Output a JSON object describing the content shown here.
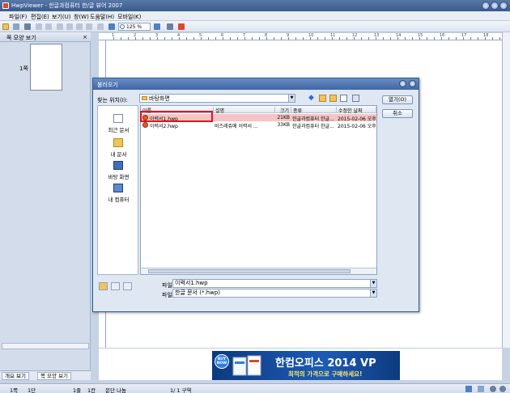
{
  "window": {
    "title": "HwpViewer - 한글과컴퓨터 한/글 뷰어 2007"
  },
  "menu": [
    "파일(F)",
    "편집(E)",
    "보기(U)",
    "창(W)",
    "도움말(H)",
    "모바일(K)"
  ],
  "toolbar": {
    "zoom": "125 %"
  },
  "left_panel": {
    "title": "쪽 모양 보기",
    "page_label": "1쪽",
    "tabs": [
      "개요 보기",
      "쪽 모양 보기"
    ]
  },
  "ruler_numbers": [
    "1",
    "2",
    "3",
    "4",
    "5",
    "6",
    "7",
    "8",
    "9",
    "10",
    "11",
    "12",
    "13",
    "14",
    "15",
    "16",
    "17",
    "18"
  ],
  "dialog": {
    "title": "불러오기",
    "lookin_label": "찾는 위치(I):",
    "lookin_value": "바탕화면",
    "places": [
      "최근 문서",
      "내 문서",
      "바탕 화면",
      "내 컴퓨터"
    ],
    "columns": [
      "이름",
      "설명",
      "크기",
      "종류",
      "수정한 날짜"
    ],
    "files": [
      {
        "name": "이력서1.hwp",
        "desc": "",
        "size": "21KB",
        "type": "한글과컴퓨터 한글...",
        "date": "2015-02-06 오후 5"
      },
      {
        "name": "이력서2.hwp",
        "desc": "비즈레쥬메 이력서 ...",
        "size": "33KB",
        "type": "한글과컴퓨터 한글...",
        "date": "2015-02-06 오후 5"
      }
    ],
    "open_button": "열기(O)",
    "cancel_button": "취소",
    "filename_label": "파일 이름(N):",
    "filename_value": "이력서1.hwp",
    "filetype_label": "파일 형식(T):",
    "filetype_value": "한글 문서 (*.hwp)"
  },
  "banner": {
    "badge": "BUY NOW",
    "headline": "한컴오피스 2014 VP",
    "sub": "최적의 가격으로 구매하세요!"
  },
  "status": {
    "page": "1쪽",
    "section": "1단",
    "line": "1줄",
    "col": "1칸",
    "break": "문단 나눔",
    "total": "1/  1 구역"
  },
  "colors": {
    "title_bar": "#3a5b8e",
    "highlight": "#e0141a",
    "selected_row": "#f6c4c4"
  }
}
